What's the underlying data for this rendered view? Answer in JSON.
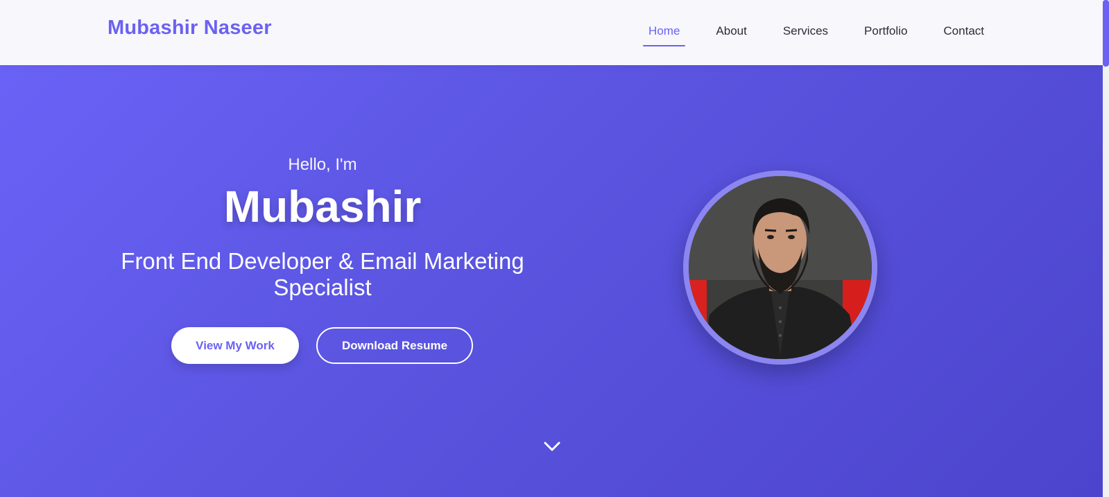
{
  "brand": {
    "name": "Mubashir Naseer"
  },
  "nav": {
    "items": [
      {
        "label": "Home",
        "active": true
      },
      {
        "label": "About",
        "active": false
      },
      {
        "label": "Services",
        "active": false
      },
      {
        "label": "Portfolio",
        "active": false
      },
      {
        "label": "Contact",
        "active": false
      }
    ]
  },
  "hero": {
    "greeting": "Hello, I'm",
    "name": "Mubashir",
    "title": "Front End Developer & Email Marketing Specialist",
    "primary_button": "View My Work",
    "secondary_button": "Download Resume",
    "scroll_icon": "chevron-down-icon"
  },
  "colors": {
    "accent": "#6b61f2",
    "hero_gradient_start": "#6a62f6",
    "hero_gradient_end": "#4c44cc",
    "nav_background": "#f7f7fc"
  }
}
